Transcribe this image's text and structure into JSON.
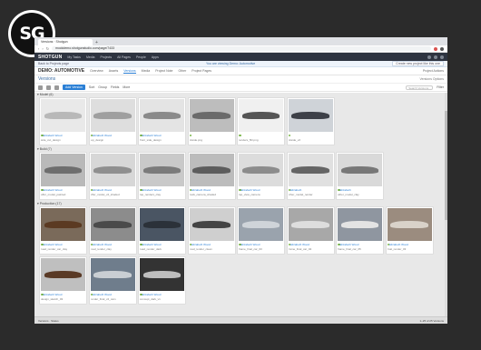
{
  "logo": {
    "text": "SG"
  },
  "browser": {
    "tab_title": "Versions · Shotgun",
    "url": "mockdemo.shotgunstudio.com/page/7433",
    "back": "‹",
    "forward": "›",
    "reload": "↻"
  },
  "app": {
    "brand": "SHOTGUN",
    "menu": [
      "My Tasks",
      "Media",
      "Projects",
      "All Pages",
      "People",
      "Apps"
    ]
  },
  "banner": {
    "left": "Back to Projects page",
    "middle": "You are viewing Demo: Automotive",
    "button": "Create new project like this one"
  },
  "project": {
    "name": "DEMO: AUTOMOTIVE",
    "tabs": [
      "Overview",
      "Assets",
      "Versions",
      "Media",
      "Project Note",
      "Other",
      "Project Pages"
    ],
    "active_tab": "Versions",
    "right": "Project Actions"
  },
  "page": {
    "title": "Versions",
    "right": "Versions Options"
  },
  "toolbar": {
    "add_label": "Add Version",
    "items": [
      "Sort",
      "Group",
      "Fields",
      "More"
    ],
    "search_placeholder": "Search Versions...",
    "filter": "Filter"
  },
  "groups": [
    {
      "label": "▾ Model (6)",
      "cards": [
        {
          "tone": "#e9e9e9",
          "car": "#b8b8b8",
          "user": "Elizabeth Wood",
          "name": "side_cut_design"
        },
        {
          "tone": "#dedede",
          "car": "#9f9f9f",
          "user": "Elizabeth Wood",
          "name": "top_design"
        },
        {
          "tone": "#e4e4e4",
          "car": "#8a8a8a",
          "user": "Elizabeth Wood",
          "name": "front_side_design"
        },
        {
          "tone": "#bdbdbd",
          "car": "#6a6a6a",
          "user": "",
          "name": "bkside.png"
        },
        {
          "tone": "#f0f0f0",
          "car": "#555555",
          "user": "",
          "name": "renders_5D.png"
        },
        {
          "tone": "#cfd3d8",
          "car": "#3d4048",
          "user": "",
          "name": "bkside_v2"
        }
      ]
    },
    {
      "label": "▾ Build (7)",
      "cards": [
        {
          "tone": "#b9b9b9",
          "car": "#6e6e6e",
          "user": "Elizabeth Wood",
          "name": "offer_model_painted"
        },
        {
          "tone": "#d7d7d7",
          "car": "#8f8f8f",
          "user": "Elizabeth Wood",
          "name": "offer_model_v2_shaded"
        },
        {
          "tone": "#c9c9c9",
          "car": "#7b7b7b",
          "user": "Elizabeth Wood",
          "name": "top_renders_clay"
        },
        {
          "tone": "#bcbcbc",
          "car": "#5d5d5d",
          "user": "Elizabeth Wood",
          "name": "back_camera_shaded"
        },
        {
          "tone": "#dcdcdc",
          "car": "#8c8c8c",
          "user": "Elizabeth Wood",
          "name": "top_view_camera"
        },
        {
          "tone": "#e0e0e0",
          "car": "#656565",
          "user": "Elizabeth",
          "name": "other_model_render"
        },
        {
          "tone": "#d9d9d9",
          "car": "#777777",
          "user": "Elizabeth",
          "name": "other_model_clay"
        }
      ]
    },
    {
      "label": "▾ Production (17)",
      "cards": [
        {
          "tone": "#7a6a5a",
          "car": "#5b3a22",
          "user": "Elizabeth Wood",
          "name": "road_render_car_clay"
        },
        {
          "tone": "#8c8c8c",
          "car": "#4a4a4a",
          "user": "Elizabeth Wood",
          "name": "road_render_clay"
        },
        {
          "tone": "#4a5563",
          "car": "#2b3139",
          "user": "Elizabeth Wood",
          "name": "road_render_dark"
        },
        {
          "tone": "#cfcfcf",
          "car": "#444444",
          "user": "Elizabeth Wood",
          "name": "road_render_clean"
        },
        {
          "tone": "#9aa3ad",
          "car": "#cfd4d9",
          "user": "Elizabeth Wood",
          "name": "frame_final_car_03"
        },
        {
          "tone": "#a8a8a8",
          "car": "#dddddd",
          "user": "Elizabeth Wood",
          "name": "frame_final_car_04"
        },
        {
          "tone": "#8f96a0",
          "car": "#e3e3e3",
          "user": "Elizabeth Wood",
          "name": "frame_final_car_05"
        },
        {
          "tone": "#9b8c7f",
          "car": "#d9d2c9",
          "user": "Elizabeth Wood",
          "name": "final_render_03"
        }
      ]
    },
    {
      "label": "",
      "cards": [
        {
          "tone": "#bfbfbf",
          "car": "#5a3a26",
          "user": "Elizabeth Wood",
          "name": "design_sketch_03"
        },
        {
          "tone": "#6f7d8c",
          "car": "#c9ced3",
          "user": "Elizabeth Wood",
          "name": "render_final_v2_cam"
        },
        {
          "tone": "#333333",
          "car": "#bdbdbd",
          "user": "Elizabeth Wood",
          "name": "concept_dark_v1"
        }
      ]
    }
  ],
  "bottombar": {
    "left": "Versions · Status",
    "page": "1–25 of 25 Versions"
  }
}
